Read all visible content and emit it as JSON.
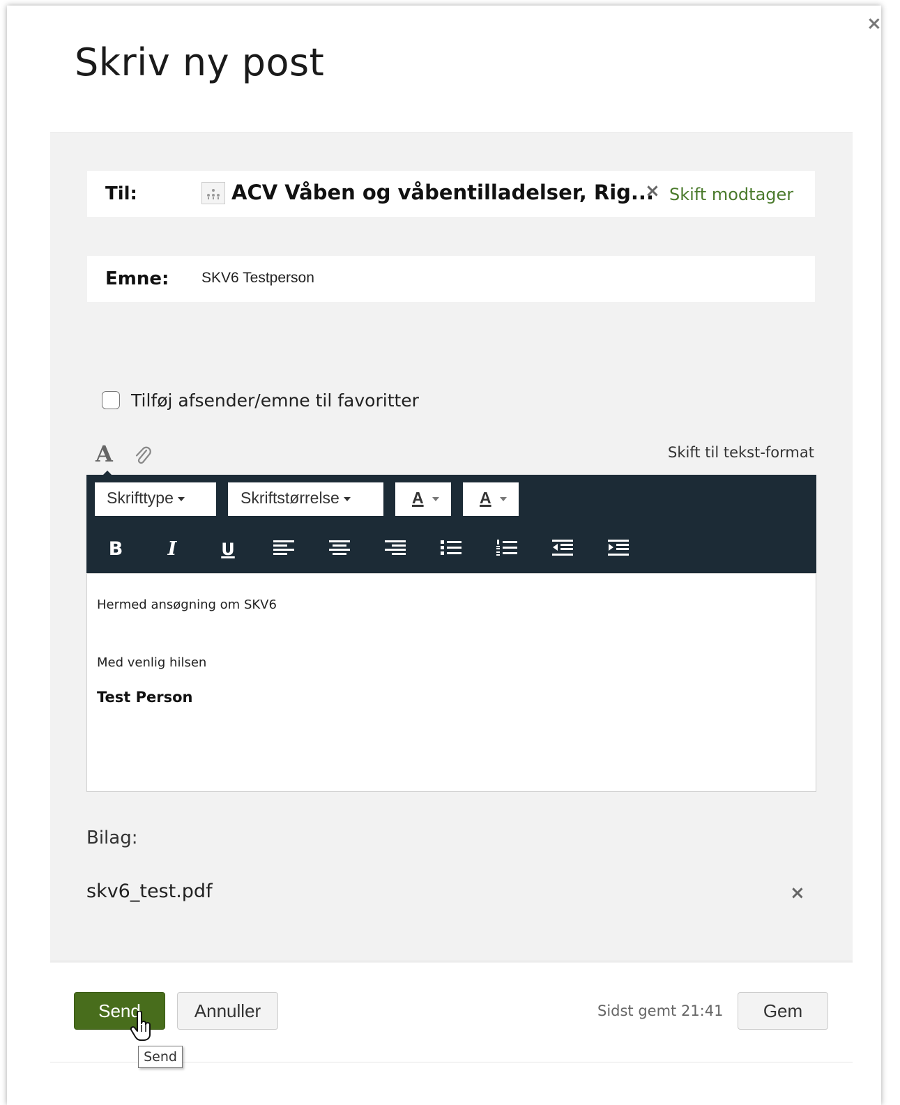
{
  "dialog": {
    "title": "Skriv ny post",
    "close_glyph": "×"
  },
  "to": {
    "label": "Til:",
    "recipient": "ACV Våben og våbentilladelser, Rig...",
    "recipient_icon": "org-chart-icon",
    "remove_glyph": "×",
    "change_label": "Skift modtager"
  },
  "subject": {
    "label": "Emne:",
    "value": "SKV6 Testperson"
  },
  "favorites": {
    "label": "Tilføj afsender/emne til favoritter",
    "checked": false
  },
  "editor_modes": {
    "font_icon": "font-format-icon",
    "attach_icon": "paperclip-icon",
    "switch_label": "Skift til tekst-format"
  },
  "toolbar": {
    "font_dropdown": "Skrifttype",
    "size_dropdown": "Skriftstørrelse",
    "fore_color": "A",
    "back_color": "A",
    "bold": "B",
    "italic": "I",
    "underline": "U"
  },
  "body": {
    "line1": "Hermed ansøgning om SKV6",
    "line2": "Med venlig hilsen",
    "line3": "Test Person"
  },
  "attachments": {
    "heading": "Bilag:",
    "items": [
      {
        "name": "skv6_test.pdf",
        "remove_glyph": "×"
      }
    ]
  },
  "footer": {
    "send_label": "Send",
    "cancel_label": "Annuller",
    "saved_text": "Sidst gemt 21:41",
    "save_label": "Gem",
    "tooltip": "Send"
  },
  "colors": {
    "accent_green": "#486d1c",
    "link_green": "#4a7a2c",
    "toolbar_bg": "#1c2b36",
    "panel_bg": "#f2f2f2"
  }
}
